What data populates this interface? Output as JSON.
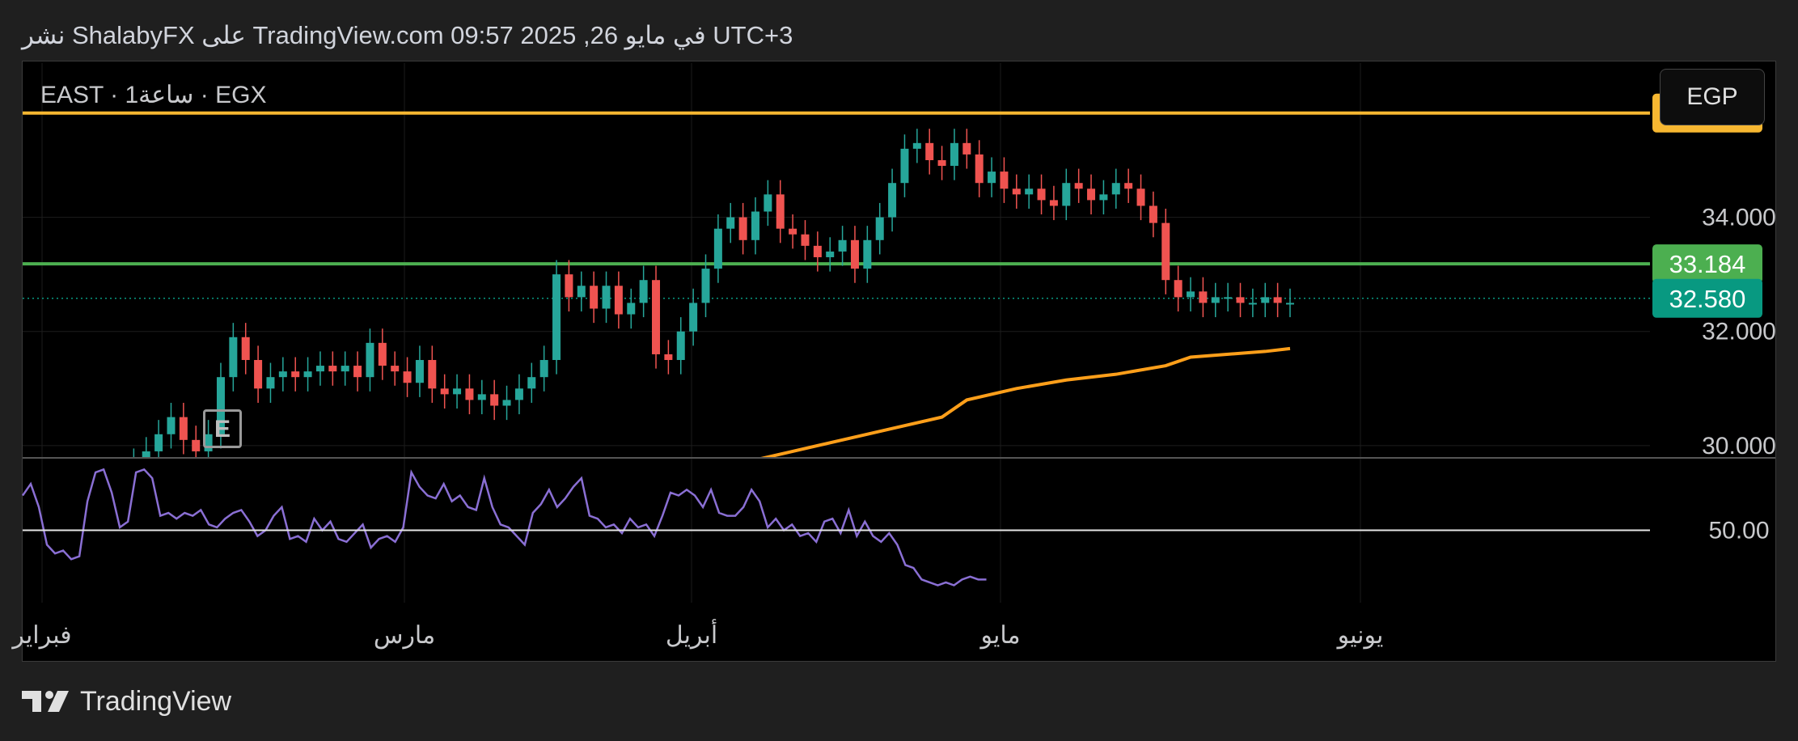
{
  "header": {
    "title": "نشر ShalabyFX على TradingView.com في مايو 26, 2025 09:57 UTC+3"
  },
  "symbol_line": "EAST · 1ساعة · EGX",
  "currency_button": "EGP",
  "marker_label": "E",
  "footer": {
    "brand": "TradingView"
  },
  "colors": {
    "resistance": "#f7b731",
    "support": "#4caf50",
    "last_price": "#089981",
    "moving_average": "#ff9f1a",
    "rsi_line": "#8a6fd4",
    "bull_candle": "#26a69a",
    "bear_candle": "#ef5350"
  },
  "chart_data": {
    "type": "line",
    "price_axis": {
      "ticks": [
        "34.000",
        "32.000",
        "30.000"
      ],
      "tick_values": [
        34.0,
        32.0,
        30.0
      ],
      "ylim": [
        29.8,
        36.7
      ],
      "levels": [
        {
          "label": "35.825",
          "value": 35.825,
          "kind": "resistance"
        },
        {
          "label": "33.184",
          "value": 33.184,
          "kind": "support"
        },
        {
          "label": "32.580",
          "value": 32.58,
          "kind": "last-price"
        }
      ]
    },
    "rsi_axis": {
      "ticks": [
        "50.00"
      ],
      "tick_values": [
        50
      ],
      "ylim": [
        25,
        75
      ]
    },
    "time_axis": {
      "labels": [
        "فبراير",
        "مارس",
        "أبريل",
        "مايو",
        "يونيو"
      ]
    },
    "price_series": {
      "x": [
        0,
        5,
        10,
        15,
        20,
        25,
        30,
        35,
        40,
        45,
        50,
        55,
        60,
        65,
        70,
        75,
        80,
        85,
        90,
        95,
        100,
        105,
        110,
        115,
        120,
        125,
        130,
        135,
        140,
        145,
        150,
        155,
        160,
        165,
        170,
        175,
        180,
        185,
        190,
        195,
        200,
        205,
        210,
        215,
        220,
        225,
        230,
        235,
        240,
        245,
        250,
        255,
        260,
        265,
        270,
        275,
        280,
        285,
        290,
        295,
        300,
        305,
        310,
        315,
        320,
        325,
        330,
        335,
        340,
        345,
        350,
        355,
        360,
        365,
        370,
        375,
        380,
        385,
        390,
        395,
        400,
        405,
        410,
        415,
        420,
        425,
        430,
        435,
        440,
        445,
        450,
        455,
        460,
        465,
        470
      ],
      "y": [
        29.6,
        29.7,
        29.9,
        30.2,
        30.5,
        30.1,
        29.9,
        30.2,
        31.2,
        31.9,
        31.5,
        31.0,
        31.2,
        31.3,
        31.2,
        31.3,
        31.4,
        31.3,
        31.4,
        31.2,
        31.8,
        31.4,
        31.3,
        31.1,
        31.5,
        31.0,
        30.9,
        31.0,
        30.8,
        30.9,
        30.7,
        30.8,
        31.0,
        31.2,
        31.5,
        33.0,
        32.6,
        32.8,
        32.4,
        32.8,
        32.3,
        32.5,
        32.9,
        31.6,
        31.5,
        32.0,
        32.5,
        33.1,
        33.8,
        34.0,
        33.6,
        34.1,
        34.4,
        33.8,
        33.7,
        33.5,
        33.3,
        33.4,
        33.6,
        33.1,
        33.6,
        34.0,
        34.6,
        35.2,
        35.3,
        35.0,
        34.9,
        35.3,
        35.1,
        34.6,
        34.8,
        34.5,
        34.4,
        34.5,
        34.3,
        34.2,
        34.6,
        34.5,
        34.3,
        34.4,
        34.6,
        34.5,
        34.2,
        33.9,
        32.9,
        32.6,
        32.7,
        32.5,
        32.6,
        32.6,
        32.5,
        32.5,
        32.6,
        32.5,
        32.5
      ]
    },
    "moving_average": {
      "x": [
        250,
        270,
        290,
        310,
        330,
        340,
        360,
        380,
        400,
        420,
        430,
        460,
        470
      ],
      "y": [
        29.7,
        29.9,
        30.1,
        30.3,
        30.5,
        30.8,
        31.0,
        31.15,
        31.25,
        31.4,
        31.55,
        31.65,
        31.7
      ]
    },
    "rsi_series": {
      "x": [
        0,
        3,
        6,
        9,
        12,
        15,
        18,
        21,
        24,
        27,
        30,
        33,
        36,
        39,
        42,
        45,
        48,
        51,
        54,
        57,
        60,
        63,
        66,
        69,
        72,
        75,
        78,
        81,
        84,
        87,
        90,
        93,
        96,
        99,
        102,
        105,
        108,
        111,
        114,
        117,
        120,
        123,
        126,
        129,
        132,
        135,
        138,
        141,
        144,
        147,
        150,
        153,
        156,
        159,
        162,
        165,
        168,
        171,
        174,
        177,
        180,
        183,
        186,
        189,
        192,
        195,
        198,
        201,
        204,
        207,
        210,
        213,
        216,
        219,
        222,
        225,
        228,
        231,
        234,
        237,
        240,
        243,
        246,
        249,
        252,
        255,
        258,
        261,
        264,
        267,
        270,
        273,
        276,
        279,
        282,
        285,
        288,
        291,
        294,
        297,
        300,
        303,
        306,
        309,
        312,
        315,
        318,
        321,
        324,
        327,
        330,
        333,
        336,
        339,
        342,
        345,
        348,
        351,
        354,
        357,
        360,
        363,
        366,
        369,
        372,
        375,
        378,
        381,
        384,
        387,
        390,
        393,
        396,
        399,
        402,
        405,
        408,
        411,
        414,
        417,
        420,
        423,
        426,
        429,
        432,
        435,
        438,
        441,
        444,
        447,
        450,
        453,
        456,
        459,
        462,
        465,
        468
      ],
      "y": [
        62,
        66,
        58,
        45,
        42,
        43,
        40,
        41,
        60,
        70,
        71,
        63,
        51,
        53,
        70,
        71,
        68,
        55,
        56,
        54,
        56,
        55,
        57,
        52,
        51,
        54,
        56,
        57,
        53,
        48,
        50,
        55,
        58,
        47,
        48,
        46,
        54,
        50,
        53,
        47,
        46,
        49,
        52,
        44,
        47,
        48,
        46,
        51,
        70,
        65,
        62,
        61,
        66,
        60,
        62,
        58,
        57,
        68,
        58,
        52,
        51,
        48,
        45,
        56,
        59,
        64,
        58,
        61,
        65,
        68,
        55,
        54,
        51,
        52,
        49,
        54,
        51,
        52,
        48,
        55,
        63,
        62,
        64,
        62,
        58,
        64,
        56,
        55,
        55,
        58,
        64,
        60,
        51,
        54,
        50,
        52,
        48,
        49,
        46,
        53,
        54,
        49,
        57,
        48,
        53,
        48,
        46,
        49,
        45,
        38,
        37,
        33,
        32,
        31,
        32,
        31,
        33,
        34,
        33,
        33
      ]
    }
  }
}
